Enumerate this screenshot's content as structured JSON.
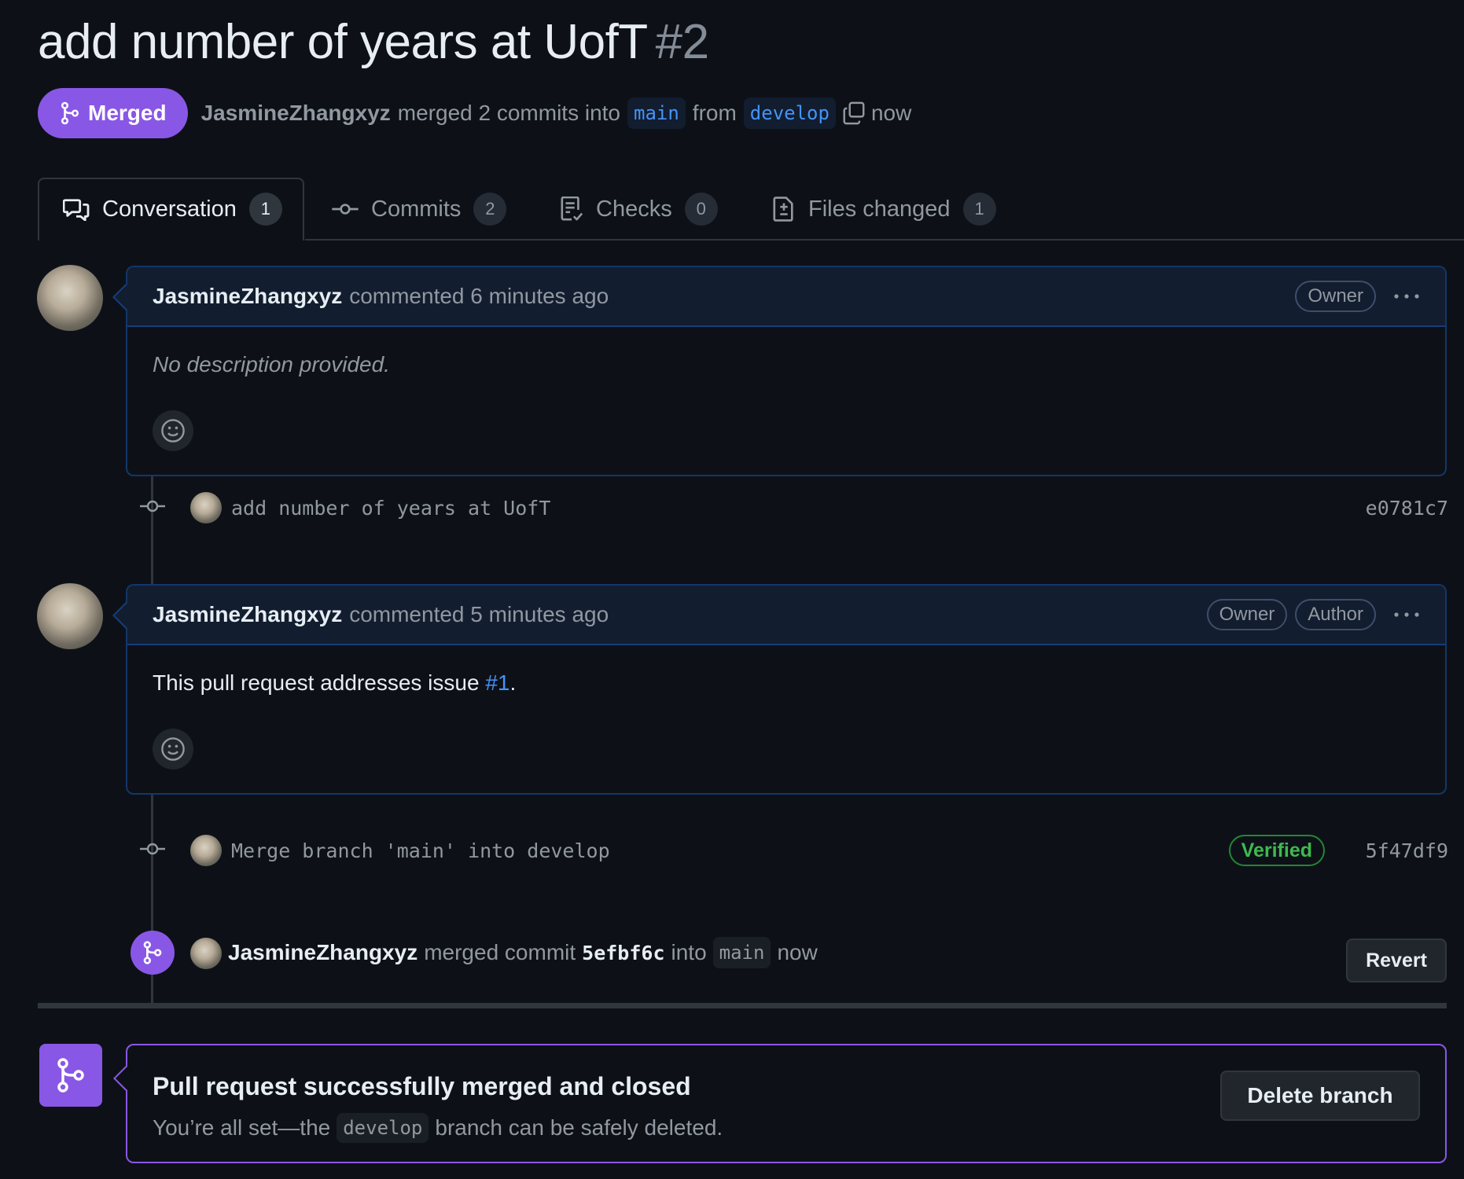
{
  "pr": {
    "title": "add number of years at UofT",
    "number": "#2",
    "state": "Merged",
    "author": "JasmineZhangxyz",
    "merged_text": "merged 2 commits into",
    "base_branch": "main",
    "from_text": "from",
    "head_branch": "develop",
    "time": "now"
  },
  "tabs": [
    {
      "label": "Conversation",
      "count": "1",
      "icon": "comment-discussion-icon"
    },
    {
      "label": "Commits",
      "count": "2",
      "icon": "git-commit-icon"
    },
    {
      "label": "Checks",
      "count": "0",
      "icon": "checklist-icon"
    },
    {
      "label": "Files changed",
      "count": "1",
      "icon": "file-diff-icon"
    }
  ],
  "comments": [
    {
      "author": "JasmineZhangxyz",
      "action": "commented 6 minutes ago",
      "roles": [
        "Owner"
      ],
      "body": "No description provided."
    },
    {
      "author": "JasmineZhangxyz",
      "action": "commented 5 minutes ago",
      "roles": [
        "Owner",
        "Author"
      ],
      "body_prefix": "This pull request addresses issue ",
      "body_link": "#1",
      "body_suffix": "."
    }
  ],
  "commits": [
    {
      "message": "add number of years at UofT",
      "sha": "e0781c7"
    },
    {
      "message": "Merge branch 'main' into develop",
      "sha": "5f47df9",
      "badge": "Verified"
    }
  ],
  "merge_event": {
    "author": "JasmineZhangxyz",
    "text": "merged commit",
    "sha": "5efbf6c",
    "into": "into",
    "branch": "main",
    "time": "now",
    "revert_label": "Revert"
  },
  "merge_box": {
    "heading": "Pull request successfully merged and closed",
    "sub_prefix": "You’re all set—the",
    "branch": "develop",
    "sub_suffix": "branch can be safely deleted.",
    "delete_label": "Delete branch"
  },
  "colors": {
    "merged": "#8957e5",
    "link": "#4493f8",
    "verified": "#3fb950",
    "bg": "#0d1117"
  }
}
